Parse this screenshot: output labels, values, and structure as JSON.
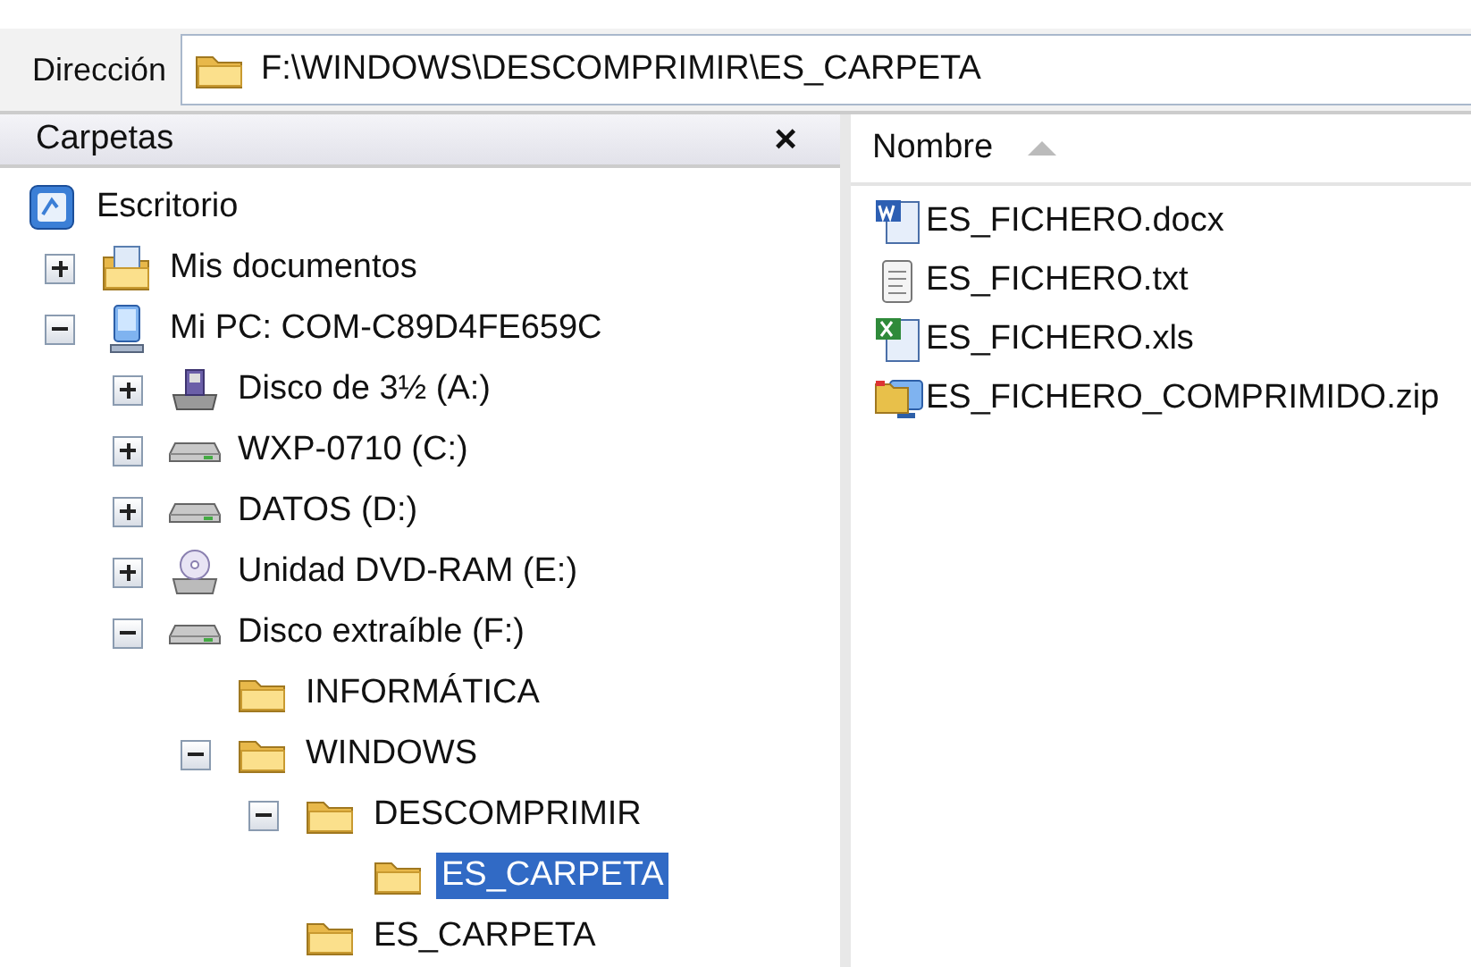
{
  "address_bar": {
    "label": "Dirección",
    "value": "F:\\WINDOWS\\DESCOMPRIMIR\\ES_CARPETA"
  },
  "folders_pane": {
    "title": "Carpetas",
    "close": "×",
    "tree": [
      {
        "label": "Escritorio",
        "kind": "desktop",
        "selected": false,
        "children": [
          {
            "label": "Mis documentos",
            "kind": "documents",
            "expanded": false,
            "selected": false
          },
          {
            "label": "Mi PC: COM-C89D4FE659C",
            "kind": "computer",
            "expanded": true,
            "selected": false,
            "children": [
              {
                "label": "Disco de 3½ (A:)",
                "kind": "floppy",
                "expanded": false,
                "selected": false
              },
              {
                "label": "WXP-0710 (C:)",
                "kind": "drive",
                "expanded": false,
                "selected": false
              },
              {
                "label": "DATOS (D:)",
                "kind": "drive",
                "expanded": false,
                "selected": false
              },
              {
                "label": "Unidad DVD-RAM (E:)",
                "kind": "dvd",
                "expanded": false,
                "selected": false
              },
              {
                "label": "Disco extraíble (F:)",
                "kind": "drive",
                "expanded": true,
                "selected": false,
                "children": [
                  {
                    "label": "INFORMÁTICA",
                    "kind": "folder",
                    "selected": false
                  },
                  {
                    "label": "WINDOWS",
                    "kind": "folder",
                    "expanded": true,
                    "selected": false,
                    "children": [
                      {
                        "label": "DESCOMPRIMIR",
                        "kind": "folder",
                        "expanded": true,
                        "selected": false,
                        "children": [
                          {
                            "label": "ES_CARPETA",
                            "kind": "folder",
                            "selected": true
                          }
                        ]
                      },
                      {
                        "label": "ES_CARPETA",
                        "kind": "folder",
                        "selected": false
                      }
                    ]
                  }
                ]
              }
            ]
          }
        ]
      }
    ]
  },
  "file_list": {
    "columns": [
      {
        "label": "Nombre",
        "sorted": true
      }
    ],
    "files": [
      {
        "name": "ES_FICHERO.docx",
        "kind": "word"
      },
      {
        "name": "ES_FICHERO.txt",
        "kind": "text"
      },
      {
        "name": "ES_FICHERO.xls",
        "kind": "excel"
      },
      {
        "name": "ES_FICHERO_COMPRIMIDO.zip",
        "kind": "archive"
      }
    ]
  }
}
